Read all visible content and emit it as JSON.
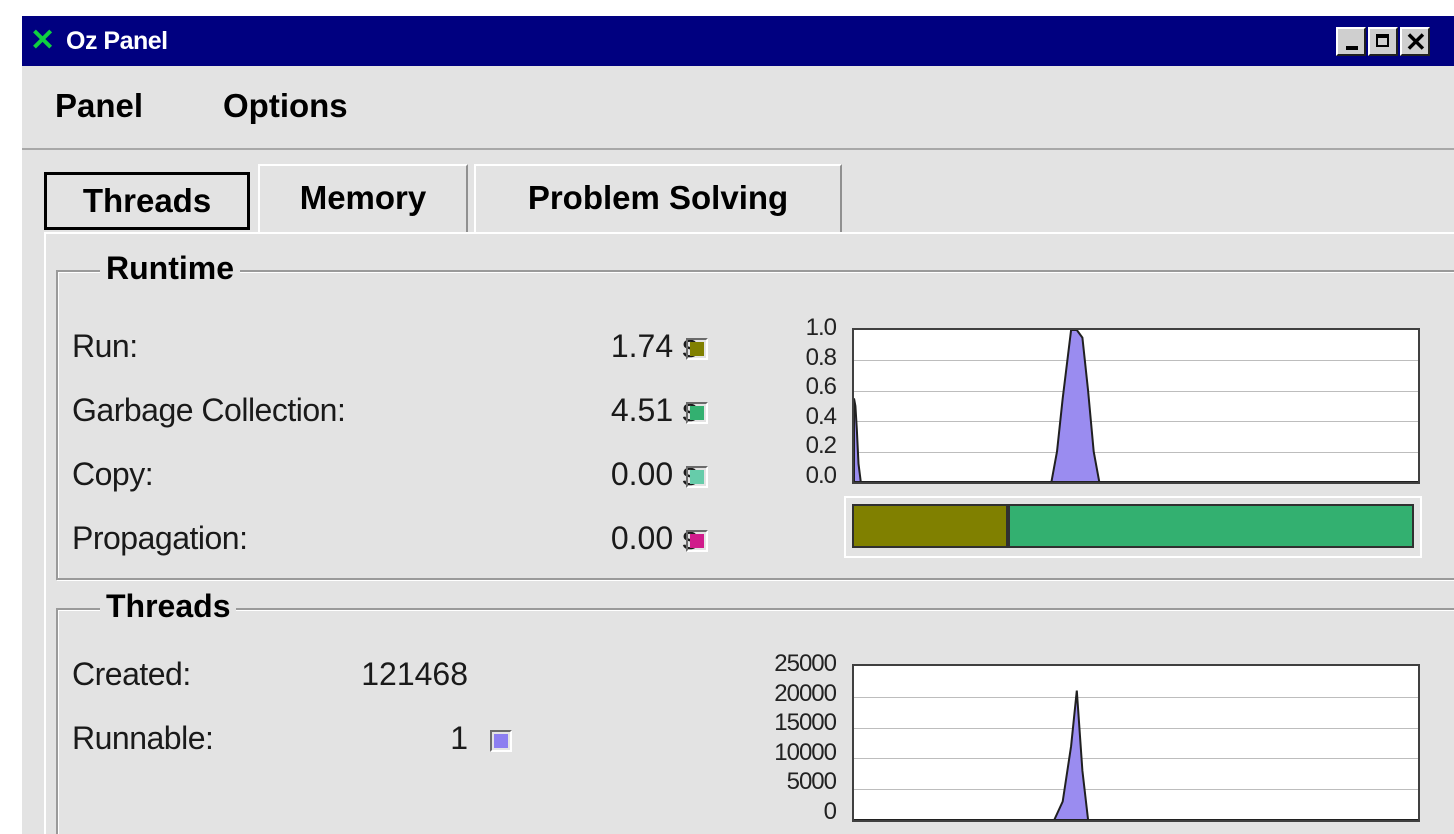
{
  "window": {
    "title": "Oz Panel",
    "icon": "x-icon",
    "controls": [
      "minimize-icon",
      "maximize-icon",
      "close-icon"
    ]
  },
  "menu": {
    "panel_label": "Panel",
    "options_label": "Options"
  },
  "tabs": [
    {
      "label": "Threads",
      "selected": true
    },
    {
      "label": "Memory",
      "selected": false
    },
    {
      "label": "Problem Solving",
      "selected": false
    }
  ],
  "runtime": {
    "title": "Runtime",
    "rows": [
      {
        "label": "Run:",
        "value": "1.74 s",
        "color": "#808000"
      },
      {
        "label": "Garbage Collection:",
        "value": "4.51 s",
        "color": "#33b070"
      },
      {
        "label": "Copy:",
        "value": "0.00 s",
        "color": "#66ccaa"
      },
      {
        "label": "Propagation:",
        "value": "0.00 s",
        "color": "#d01c8b"
      }
    ],
    "chart": {
      "y_ticks": [
        "1.0",
        "0.8",
        "0.6",
        "0.4",
        "0.2",
        "0.0"
      ],
      "ylim": [
        0,
        1.0
      ],
      "fill_color": "#9a8cf0",
      "points": [
        [
          0,
          0.55
        ],
        [
          0.25,
          0.5
        ],
        [
          0.5,
          0.35
        ],
        [
          0.8,
          0.12
        ],
        [
          1.2,
          0.0
        ],
        [
          35,
          0.0
        ],
        [
          36,
          0.2
        ],
        [
          37,
          0.55
        ],
        [
          38,
          0.85
        ],
        [
          38.5,
          1.0
        ],
        [
          39.5,
          1.0
        ],
        [
          40.5,
          0.95
        ],
        [
          41.5,
          0.6
        ],
        [
          42.5,
          0.2
        ],
        [
          43.5,
          0.0
        ],
        [
          100,
          0.0
        ]
      ]
    },
    "breakdown_bar": [
      {
        "name": "Run",
        "fraction": 0.278,
        "color": "#808000"
      },
      {
        "name": "Garbage Collection",
        "fraction": 0.722,
        "color": "#33b070"
      }
    ]
  },
  "threads": {
    "title": "Threads",
    "created_label": "Created:",
    "created_value": "121468",
    "runnable_label": "Runnable:",
    "runnable_value": "1",
    "runnable_color": "#8c7ef0",
    "chart": {
      "y_ticks": [
        "25000",
        "20000",
        "15000",
        "10000",
        "5000",
        "0"
      ],
      "ylim": [
        0,
        25000
      ],
      "fill_color": "#9a8cf0",
      "points": [
        [
          0,
          0
        ],
        [
          35.5,
          0
        ],
        [
          37,
          3000
        ],
        [
          38.5,
          12000
        ],
        [
          39.5,
          21000
        ],
        [
          40.5,
          8000
        ],
        [
          41.5,
          0
        ],
        [
          100,
          0
        ]
      ]
    }
  }
}
